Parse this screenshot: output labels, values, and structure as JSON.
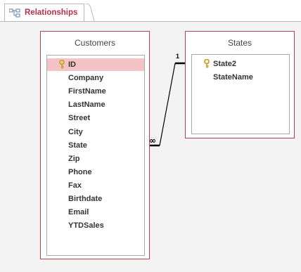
{
  "tab": {
    "label": "Relationships",
    "icon": "relationships-icon"
  },
  "tables": {
    "customers": {
      "title": "Customers",
      "fields": [
        "ID",
        "Company",
        "FirstName",
        "LastName",
        "Street",
        "City",
        "State",
        "Zip",
        "Phone",
        "Fax",
        "Birthdate",
        "Email",
        "YTDSales"
      ],
      "primary_key": "ID",
      "selected_field": "ID"
    },
    "states": {
      "title": "States",
      "fields": [
        "State2",
        "StateName"
      ],
      "primary_key": "State2"
    }
  },
  "relationship": {
    "from": "States.State2",
    "to": "Customers.State",
    "one_label": "1",
    "many_label": "∞"
  },
  "colors": {
    "accent": "#b5324a",
    "window_border": "#b84052",
    "selected_row": "#f4c3c6",
    "key_icon": "#c9a227"
  }
}
